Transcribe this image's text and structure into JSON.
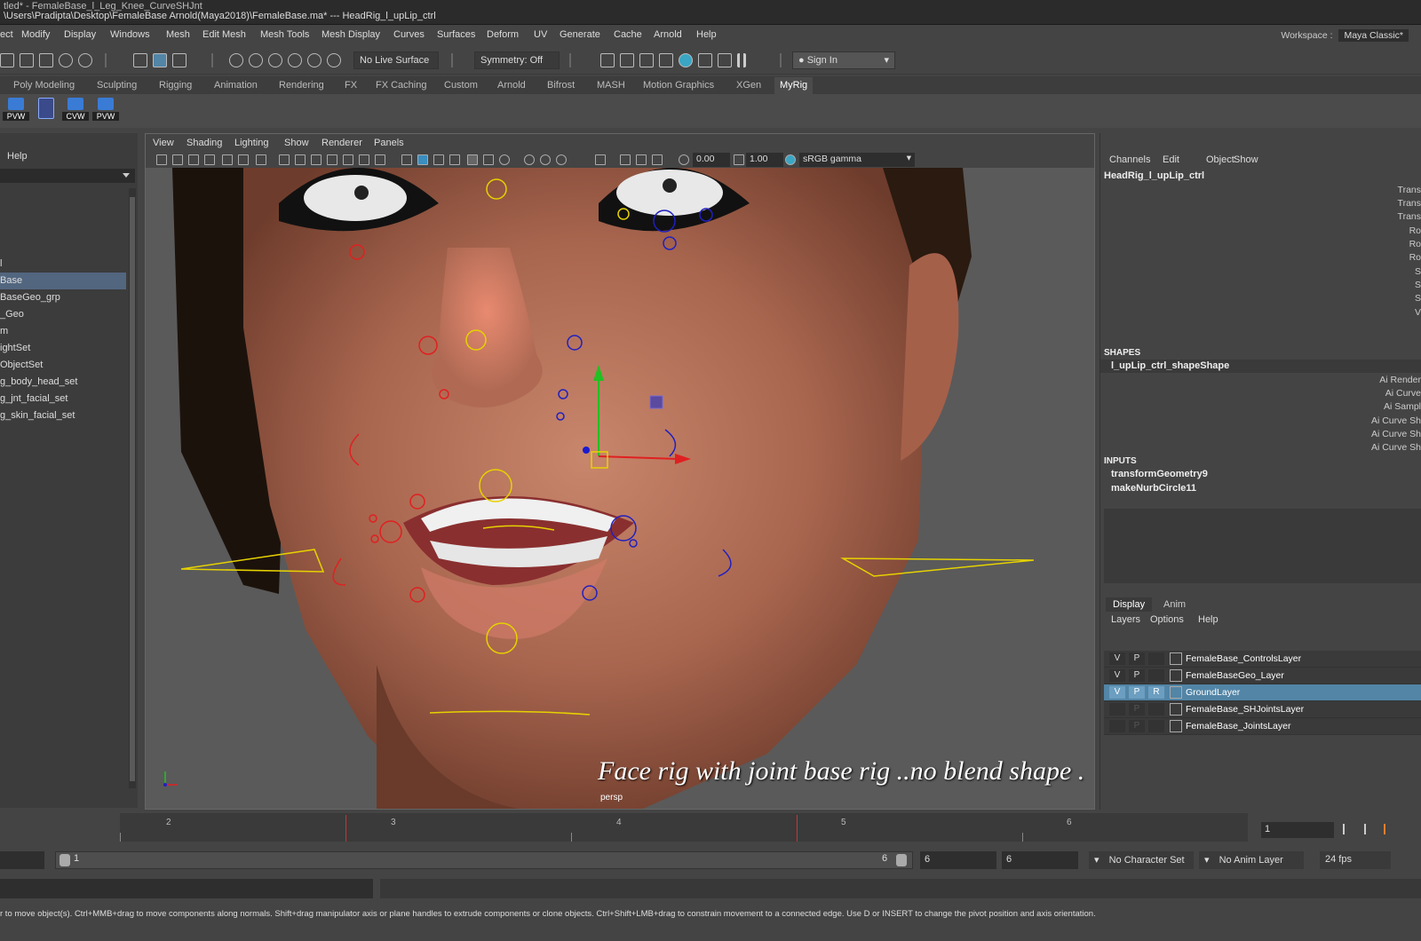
{
  "window": {
    "title_line1": "tled* - FemaleBase_l_Leg_Knee_CurveSHJnt",
    "title_line2": "\\Users\\Pradipta\\Desktop\\FemaleBase Arnold(Maya2018)\\FemaleBase.ma* --- HeadRig_l_upLip_ctrl"
  },
  "menubar": [
    "ect",
    "Modify",
    "Display",
    "Windows",
    "Mesh",
    "Edit Mesh",
    "Mesh Tools",
    "Mesh Display",
    "Curves",
    "Surfaces",
    "Deform",
    "UV",
    "Generate",
    "Cache",
    "Arnold",
    "Help"
  ],
  "workspace": {
    "label": "Workspace :",
    "value": "Maya Classic*"
  },
  "toolbar": {
    "live_surface": "No Live Surface",
    "symmetry": "Symmetry: Off",
    "sign_in": "Sign In"
  },
  "shelf_tabs": [
    "Poly Modeling",
    "Sculpting",
    "Rigging",
    "Animation",
    "Rendering",
    "FX",
    "FX Caching",
    "Custom",
    "Arnold",
    "Bifrost",
    "MASH",
    "Motion Graphics",
    "XGen",
    "MyRig"
  ],
  "shelf_active_tab": "MyRig",
  "shelf_buttons": [
    "PVW",
    "",
    "CVW",
    "PVW"
  ],
  "outliner": {
    "help": "Help",
    "items": [
      "l",
      "Base",
      "BaseGeo_grp",
      "_Geo",
      "m",
      "ightSet",
      "ObjectSet",
      "g_body_head_set",
      "g_jnt_facial_set",
      "g_skin_facial_set"
    ],
    "selected_index": 1
  },
  "viewport": {
    "menus": [
      "View",
      "Shading",
      "Lighting",
      "Show",
      "Renderer",
      "Panels"
    ],
    "exposure": "0.00",
    "gamma": "1.00",
    "color_space": "sRGB gamma",
    "camera": "persp",
    "caption": "Face rig  with joint base rig ..no blend shape ."
  },
  "channel_box": {
    "menus": [
      "Channels",
      "Edit",
      "Object",
      "Show"
    ],
    "node": "HeadRig_l_upLip_ctrl",
    "attrs": [
      "Trans",
      "Trans",
      "Trans",
      "Ro",
      "Ro",
      "Ro",
      "S",
      "S",
      "S",
      "V"
    ],
    "shapes_header": "SHAPES",
    "shape_node": "l_upLip_ctrl_shapeShape",
    "shape_attrs": [
      "Ai Render",
      "Ai Curve",
      "Ai Sampl",
      "Ai Curve Sh",
      "Ai Curve Sh",
      "Ai Curve Sh"
    ],
    "inputs_header": "INPUTS",
    "inputs": [
      "transformGeometry9",
      "makeNurbCircle11"
    ]
  },
  "layer_editor": {
    "tabs": [
      "Display",
      "Anim"
    ],
    "menus": [
      "Layers",
      "Options",
      "Help"
    ],
    "layers": [
      {
        "name": "FemaleBase_ControlsLayer",
        "v": "V",
        "p": "P",
        "r": ""
      },
      {
        "name": "FemaleBaseGeo_Layer",
        "v": "V",
        "p": "P",
        "r": ""
      },
      {
        "name": "GroundLayer",
        "v": "V",
        "p": "P",
        "r": "R"
      },
      {
        "name": "FemaleBase_SHJointsLayer",
        "v": "",
        "p": "P",
        "r": ""
      },
      {
        "name": "FemaleBase_JointsLayer",
        "v": "",
        "p": "P",
        "r": ""
      }
    ],
    "selected_index": 2
  },
  "timeline": {
    "labels": [
      "2",
      "3",
      "4",
      "5",
      "6"
    ],
    "current_frame": "1"
  },
  "range": {
    "start": "1",
    "end": "6",
    "range_end": "6",
    "anim_end": "6",
    "character_set": "No Character Set",
    "anim_layer": "No Anim Layer",
    "fps": "24 fps"
  },
  "help_line": "r to move object(s). Ctrl+MMB+drag to move components along normals. Shift+drag manipulator axis or plane handles to extrude components or clone objects. Ctrl+Shift+LMB+drag to constrain movement to a connected edge. Use D or INSERT to change the pivot position and axis orientation.",
  "colors": {
    "accent_selection": "#5285a6",
    "outliner_selection": "#52667f",
    "control_red": "#e02020",
    "control_blue": "#2020c0",
    "control_yellow": "#e6d200"
  }
}
